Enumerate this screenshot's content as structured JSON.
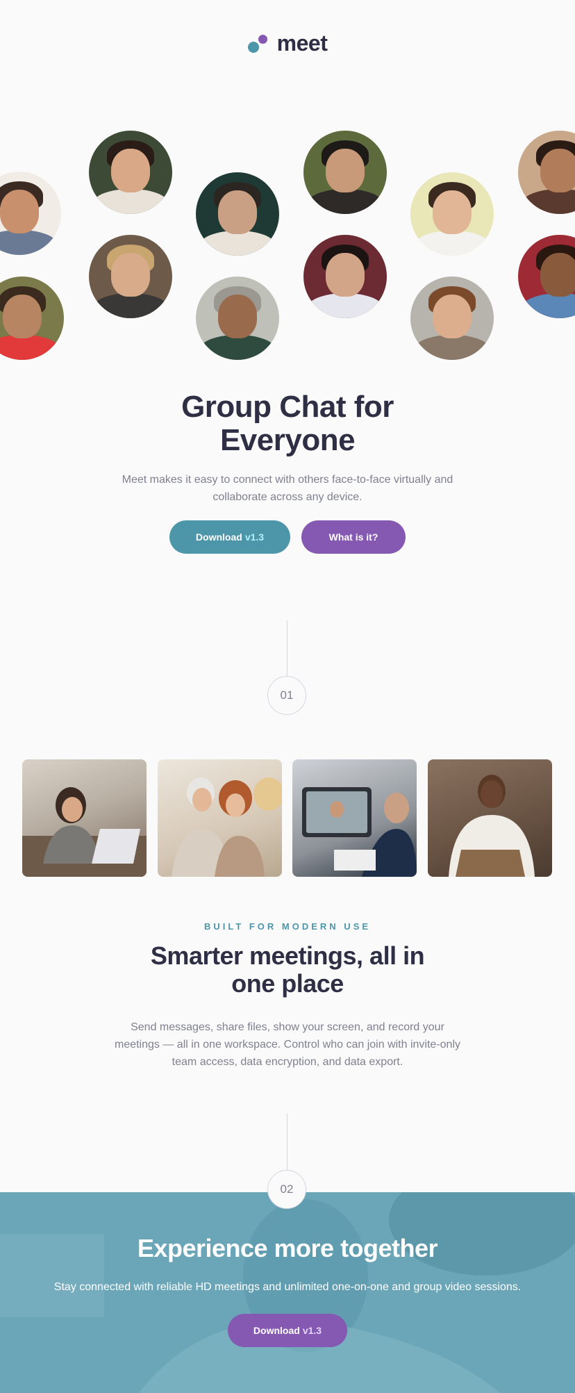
{
  "logo": {
    "text": "meet"
  },
  "hero": {
    "title_line1": "Group Chat for",
    "title_line2": "Everyone",
    "subtitle_line1": "Meet makes it easy to connect with others face-to-face virtually and",
    "subtitle_line2": "collaborate across any device.",
    "download_label": "Download",
    "download_version": "v1.3",
    "whatis_label": "What is it?"
  },
  "steps": {
    "first": "01",
    "second": "02"
  },
  "features": {
    "eyebrow": "BUILT FOR MODERN USE",
    "title_line1": "Smarter meetings, all in",
    "title_line2": "one place",
    "body_line1": "Send messages, share files, show your screen, and record your",
    "body_line2": "meetings — all in one workspace. Control who can join with invite-only",
    "body_line3": "team access, data encryption, and data export."
  },
  "banner": {
    "title": "Experience more together",
    "subtitle": "Stay connected with reliable HD meetings and unlimited one-on-one and group video sessions.",
    "download_label": "Download",
    "download_version": "v1.3"
  },
  "colors": {
    "cyan": "#4d96a9",
    "purple": "#8558b1",
    "dark_text": "#2e2f45",
    "muted_text": "#7f8090",
    "banner_bg": "#6aa6b8"
  }
}
